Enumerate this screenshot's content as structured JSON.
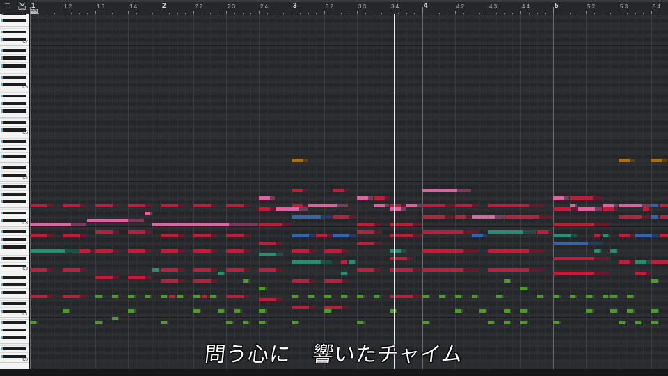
{
  "ruler": {
    "time_signature": "4/4",
    "labels": [
      {
        "beat": 0,
        "text": "1"
      },
      {
        "beat": 1,
        "text": "1.2"
      },
      {
        "beat": 2,
        "text": "1.3"
      },
      {
        "beat": 3,
        "text": "1.4"
      },
      {
        "beat": 4,
        "text": "2"
      },
      {
        "beat": 5,
        "text": "2.2"
      },
      {
        "beat": 6,
        "text": "2.3"
      },
      {
        "beat": 7,
        "text": "2.4"
      },
      {
        "beat": 8,
        "text": "3"
      },
      {
        "beat": 9,
        "text": "3.2"
      },
      {
        "beat": 10,
        "text": "3.3"
      },
      {
        "beat": 11,
        "text": "3.4"
      },
      {
        "beat": 12,
        "text": "4"
      },
      {
        "beat": 13,
        "text": "4.2"
      },
      {
        "beat": 14,
        "text": "4.3"
      },
      {
        "beat": 15,
        "text": "4.4"
      },
      {
        "beat": 16,
        "text": "5"
      },
      {
        "beat": 17,
        "text": "5.2"
      },
      {
        "beat": 18,
        "text": "5.3"
      },
      {
        "beat": 19,
        "text": "5.4"
      }
    ]
  },
  "toolbar": {
    "icons": [
      "list-icon",
      "drum-icon"
    ]
  },
  "keyboard": {
    "octave_labels": [
      {
        "pitch": 84,
        "text": "C7"
      },
      {
        "pitch": 72,
        "text": "C6"
      },
      {
        "pitch": 60,
        "text": "C5"
      },
      {
        "pitch": 48,
        "text": "C4"
      },
      {
        "pitch": 36,
        "text": "C3"
      },
      {
        "pitch": 24,
        "text": "C2"
      },
      {
        "pitch": 12,
        "text": "C1"
      },
      {
        "pitch": 0,
        "text": "C0"
      }
    ]
  },
  "colors": {
    "r": "#b8203c",
    "p": "#d8659e",
    "t": "#2a8c72",
    "b": "#3564a8",
    "g": "#4e9a2c",
    "o": "#a0701e"
  },
  "playhead_beat": 11.13,
  "notes_format": "[start_16th, length_16ths, pitch, color]",
  "notes": [
    [
      0,
      3,
      41,
      "r"
    ],
    [
      4,
      3,
      41,
      "r"
    ],
    [
      8,
      3,
      41,
      "r"
    ],
    [
      12,
      3,
      41,
      "r"
    ],
    [
      0,
      7,
      36,
      "p"
    ],
    [
      7,
      7,
      37,
      "p"
    ],
    [
      14,
      1,
      39,
      "p"
    ],
    [
      15,
      13,
      36,
      "p"
    ],
    [
      8,
      3,
      34,
      "r"
    ],
    [
      12,
      3,
      34,
      "r"
    ],
    [
      0,
      3,
      33,
      "r"
    ],
    [
      4,
      3,
      33,
      "r"
    ],
    [
      0,
      6,
      29,
      "t"
    ],
    [
      6,
      2,
      29,
      "r"
    ],
    [
      8,
      3,
      29,
      "r"
    ],
    [
      12,
      3,
      29,
      "r"
    ],
    [
      0,
      3,
      24,
      "r"
    ],
    [
      4,
      3,
      24,
      "r"
    ],
    [
      15,
      1,
      24,
      "t"
    ],
    [
      8,
      3,
      22,
      "r"
    ],
    [
      12,
      3,
      22,
      "r"
    ],
    [
      0,
      3,
      17,
      "r"
    ],
    [
      4,
      3,
      17,
      "r"
    ],
    [
      8,
      1,
      17,
      "g"
    ],
    [
      10,
      1,
      17,
      "g"
    ],
    [
      12,
      1,
      17,
      "g"
    ],
    [
      14,
      1,
      17,
      "g"
    ],
    [
      4,
      1,
      13,
      "g"
    ],
    [
      12,
      1,
      13,
      "g"
    ],
    [
      0,
      1,
      10,
      "g"
    ],
    [
      8,
      1,
      10,
      "g"
    ],
    [
      10,
      1,
      11,
      "g"
    ],
    [
      16,
      3,
      41,
      "r"
    ],
    [
      20,
      3,
      41,
      "r"
    ],
    [
      24,
      3,
      41,
      "r"
    ],
    [
      16,
      3,
      33,
      "r"
    ],
    [
      20,
      3,
      33,
      "r"
    ],
    [
      24,
      3,
      33,
      "r"
    ],
    [
      16,
      3,
      29,
      "r"
    ],
    [
      20,
      3,
      29,
      "r"
    ],
    [
      24,
      3,
      29,
      "r"
    ],
    [
      16,
      3,
      24,
      "r"
    ],
    [
      20,
      3,
      24,
      "r"
    ],
    [
      24,
      3,
      24,
      "r"
    ],
    [
      23,
      1,
      23,
      "t"
    ],
    [
      16,
      3,
      21,
      "r"
    ],
    [
      20,
      3,
      21,
      "r"
    ],
    [
      26,
      1,
      21,
      "g"
    ],
    [
      16,
      1,
      17,
      "g"
    ],
    [
      17,
      1,
      17,
      "r"
    ],
    [
      18,
      1,
      17,
      "g"
    ],
    [
      20,
      1,
      17,
      "g"
    ],
    [
      21,
      1,
      17,
      "r"
    ],
    [
      22,
      1,
      17,
      "g"
    ],
    [
      24,
      3,
      17,
      "r"
    ],
    [
      20,
      1,
      13,
      "g"
    ],
    [
      23,
      1,
      13,
      "g"
    ],
    [
      25,
      1,
      13,
      "g"
    ],
    [
      16,
      1,
      10,
      "g"
    ],
    [
      24,
      1,
      10,
      "g"
    ],
    [
      26,
      1,
      10,
      "g"
    ],
    [
      28,
      2,
      43,
      "p"
    ],
    [
      28,
      4,
      36,
      "r"
    ],
    [
      28,
      2,
      40,
      "r"
    ],
    [
      30,
      4,
      40,
      "p"
    ],
    [
      28,
      3,
      31,
      "r"
    ],
    [
      28,
      3,
      28,
      "t"
    ],
    [
      28,
      3,
      24,
      "r"
    ],
    [
      28,
      1,
      19,
      "g"
    ],
    [
      28,
      3,
      16,
      "r"
    ],
    [
      28,
      1,
      13,
      "g"
    ],
    [
      28,
      1,
      10,
      "g"
    ],
    [
      32,
      2,
      53,
      "o"
    ],
    [
      32,
      2,
      45,
      "r"
    ],
    [
      37,
      2,
      45,
      "r"
    ],
    [
      40,
      2,
      43,
      "p"
    ],
    [
      42,
      2,
      43,
      "r"
    ],
    [
      32,
      2,
      41,
      "r"
    ],
    [
      34,
      5,
      41,
      "p"
    ],
    [
      42,
      2,
      41,
      "p"
    ],
    [
      44,
      2,
      41,
      "r"
    ],
    [
      46,
      2,
      41,
      "p"
    ],
    [
      44,
      2,
      40,
      "p"
    ],
    [
      32,
      5,
      38,
      "b"
    ],
    [
      37,
      3,
      38,
      "r"
    ],
    [
      40,
      3,
      36,
      "r"
    ],
    [
      44,
      4,
      36,
      "r"
    ],
    [
      40,
      3,
      34,
      "r"
    ],
    [
      32,
      3,
      33,
      "b"
    ],
    [
      35,
      2,
      33,
      "r"
    ],
    [
      37,
      3,
      33,
      "b"
    ],
    [
      44,
      4,
      33,
      "r"
    ],
    [
      40,
      3,
      31,
      "r"
    ],
    [
      32,
      3,
      29,
      "r"
    ],
    [
      36,
      3,
      29,
      "r"
    ],
    [
      44,
      2,
      29,
      "t"
    ],
    [
      44,
      3,
      27,
      "r"
    ],
    [
      32,
      5,
      26,
      "t"
    ],
    [
      38,
      1,
      26,
      "r"
    ],
    [
      39,
      1,
      26,
      "t"
    ],
    [
      40,
      3,
      24,
      "r"
    ],
    [
      44,
      4,
      24,
      "r"
    ],
    [
      38,
      1,
      23,
      "t"
    ],
    [
      32,
      3,
      21,
      "r"
    ],
    [
      36,
      3,
      21,
      "r"
    ],
    [
      32,
      1,
      17,
      "g"
    ],
    [
      34,
      1,
      17,
      "g"
    ],
    [
      36,
      1,
      17,
      "g"
    ],
    [
      38,
      1,
      17,
      "g"
    ],
    [
      40,
      1,
      17,
      "g"
    ],
    [
      42,
      1,
      17,
      "g"
    ],
    [
      44,
      4,
      17,
      "r"
    ],
    [
      32,
      3,
      14,
      "r"
    ],
    [
      36,
      3,
      14,
      "r"
    ],
    [
      36,
      1,
      13,
      "g"
    ],
    [
      44,
      1,
      13,
      "g"
    ],
    [
      32,
      1,
      10,
      "g"
    ],
    [
      40,
      1,
      10,
      "g"
    ],
    [
      48,
      6,
      45,
      "p"
    ],
    [
      48,
      4,
      41,
      "r"
    ],
    [
      52,
      3,
      41,
      "r"
    ],
    [
      56,
      7,
      41,
      "r"
    ],
    [
      48,
      4,
      38,
      "r"
    ],
    [
      52,
      2,
      38,
      "r"
    ],
    [
      54,
      4,
      38,
      "p"
    ],
    [
      58,
      6,
      38,
      "r"
    ],
    [
      48,
      7,
      34,
      "r"
    ],
    [
      56,
      6,
      34,
      "t"
    ],
    [
      62,
      2,
      34,
      "r"
    ],
    [
      54,
      2,
      33,
      "b"
    ],
    [
      48,
      7,
      29,
      "r"
    ],
    [
      56,
      7,
      29,
      "r"
    ],
    [
      48,
      7,
      24,
      "r"
    ],
    [
      56,
      7,
      24,
      "r"
    ],
    [
      58,
      1,
      21,
      "g"
    ],
    [
      60,
      1,
      19,
      "g"
    ],
    [
      48,
      1,
      17,
      "g"
    ],
    [
      50,
      1,
      17,
      "g"
    ],
    [
      52,
      1,
      17,
      "g"
    ],
    [
      54,
      1,
      17,
      "g"
    ],
    [
      57,
      1,
      17,
      "g"
    ],
    [
      62,
      1,
      17,
      "g"
    ],
    [
      52,
      1,
      13,
      "g"
    ],
    [
      55,
      1,
      13,
      "g"
    ],
    [
      58,
      1,
      13,
      "g"
    ],
    [
      60,
      1,
      13,
      "g"
    ],
    [
      48,
      1,
      10,
      "g"
    ],
    [
      56,
      1,
      10,
      "g"
    ],
    [
      58,
      1,
      10,
      "g"
    ],
    [
      60,
      1,
      10,
      "g"
    ],
    [
      72,
      2,
      53,
      "o"
    ],
    [
      76,
      2,
      53,
      "o"
    ],
    [
      64,
      2,
      43,
      "p"
    ],
    [
      66,
      4,
      43,
      "r"
    ],
    [
      66,
      1,
      41,
      "p"
    ],
    [
      70,
      2,
      41,
      "p"
    ],
    [
      72,
      4,
      41,
      "p"
    ],
    [
      76,
      1,
      41,
      "b"
    ],
    [
      77,
      2,
      41,
      "r"
    ],
    [
      64,
      3,
      40,
      "r"
    ],
    [
      67,
      3,
      40,
      "p"
    ],
    [
      70,
      2,
      40,
      "r"
    ],
    [
      75,
      1,
      40,
      "r"
    ],
    [
      72,
      4,
      38,
      "r"
    ],
    [
      76,
      1,
      38,
      "b"
    ],
    [
      77,
      2,
      38,
      "r"
    ],
    [
      64,
      7,
      36,
      "r"
    ],
    [
      64,
      3,
      33,
      "t"
    ],
    [
      69,
      1,
      33,
      "r"
    ],
    [
      70,
      1,
      33,
      "t"
    ],
    [
      72,
      2,
      33,
      "r"
    ],
    [
      74,
      3,
      33,
      "b"
    ],
    [
      77,
      2,
      33,
      "r"
    ],
    [
      64,
      6,
      31,
      "b"
    ],
    [
      69,
      1,
      29,
      "t"
    ],
    [
      71,
      1,
      29,
      "t"
    ],
    [
      64,
      7,
      27,
      "r"
    ],
    [
      72,
      2,
      26,
      "r"
    ],
    [
      74,
      2,
      26,
      "t"
    ],
    [
      76,
      3,
      26,
      "r"
    ],
    [
      64,
      7,
      23,
      "r"
    ],
    [
      74,
      2,
      23,
      "r"
    ],
    [
      76,
      1,
      21,
      "g"
    ],
    [
      64,
      1,
      17,
      "g"
    ],
    [
      66,
      1,
      17,
      "g"
    ],
    [
      68,
      1,
      17,
      "g"
    ],
    [
      70,
      1,
      17,
      "g"
    ],
    [
      71,
      1,
      17,
      "g"
    ],
    [
      73,
      1,
      17,
      "g"
    ],
    [
      78,
      1,
      17,
      "g"
    ],
    [
      68,
      1,
      13,
      "g"
    ],
    [
      71,
      1,
      13,
      "g"
    ],
    [
      73,
      1,
      13,
      "g"
    ],
    [
      76,
      1,
      13,
      "g"
    ],
    [
      64,
      1,
      10,
      "g"
    ],
    [
      72,
      1,
      10,
      "g"
    ],
    [
      74,
      1,
      10,
      "g"
    ],
    [
      76,
      1,
      10,
      "g"
    ]
  ],
  "subtitle": "問う心に　響いたチャイム"
}
